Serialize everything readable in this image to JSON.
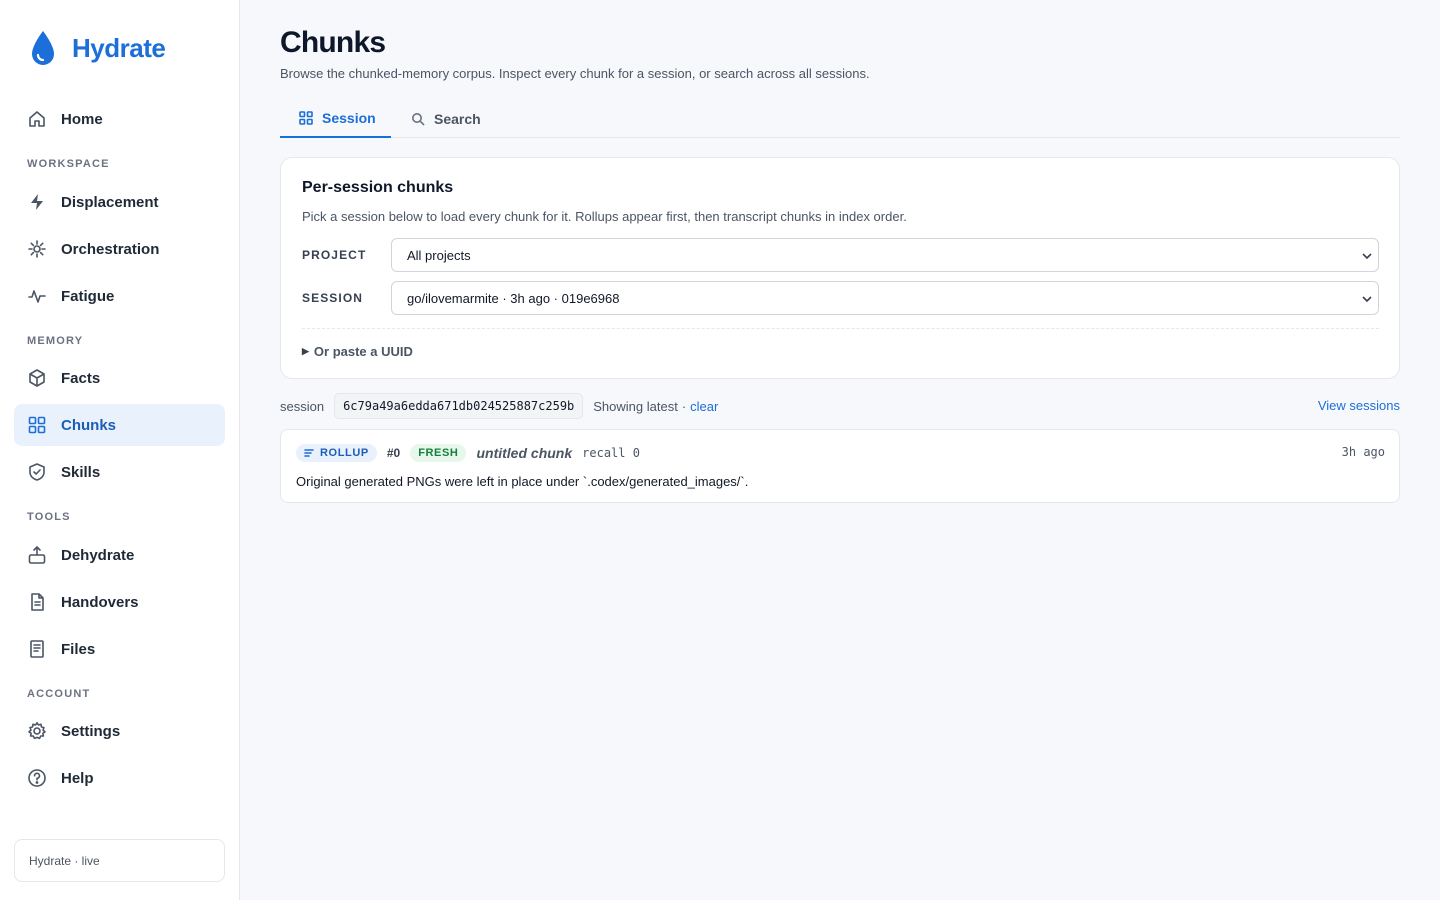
{
  "app": {
    "name": "Hydrate",
    "brand_color": "#1c6ed8"
  },
  "sidebar": {
    "home": "Home",
    "sections": {
      "workspace": "WORKSPACE",
      "memory": "MEMORY",
      "tools": "TOOLS",
      "account": "ACCOUNT"
    },
    "items": {
      "displacement": "Displacement",
      "orchestration": "Orchestration",
      "fatigue": "Fatigue",
      "facts": "Facts",
      "chunks": "Chunks",
      "skills": "Skills",
      "dehydrate": "Dehydrate",
      "handovers": "Handovers",
      "files": "Files",
      "settings": "Settings",
      "help": "Help"
    },
    "active": "Chunks",
    "footer_status": "Hydrate · live"
  },
  "page": {
    "title": "Chunks",
    "description": "Browse the chunked-memory corpus. Inspect every chunk for a session, or search across all sessions."
  },
  "tabs": [
    {
      "label": "Session",
      "icon": "grid-icon",
      "active": true
    },
    {
      "label": "Search",
      "icon": "search-icon",
      "active": false
    }
  ],
  "card": {
    "title": "Per-session chunks",
    "description": "Pick a session below to load every chunk for it. Rollups appear first, then transcript chunks in index order.",
    "project_label": "PROJECT",
    "project_value": "All projects",
    "session_label": "SESSION",
    "session_value": "go/ilovemarmite · 3h ago · 019e6968",
    "uuid_toggle": "Or paste a UUID"
  },
  "session_bar": {
    "label": "session",
    "id": "6c79a49a6edda671db024525887c259b",
    "showing": "Showing latest",
    "separator": "·",
    "clear": "clear",
    "view_sessions": "View sessions"
  },
  "chunks": [
    {
      "kind": "ROLLUP",
      "index": "#0",
      "status": "FRESH",
      "title": "untitled chunk",
      "recall": "recall 0",
      "time": "3h ago",
      "body": "Original generated PNGs were left in place under `.codex/generated_images/`."
    }
  ],
  "colors": {
    "accent": "#1c6ed8",
    "active_bg": "#e8f1fc",
    "fresh": "#15803d",
    "fresh_bg": "#e7f7ec",
    "page_bg": "#f7f8fb"
  }
}
